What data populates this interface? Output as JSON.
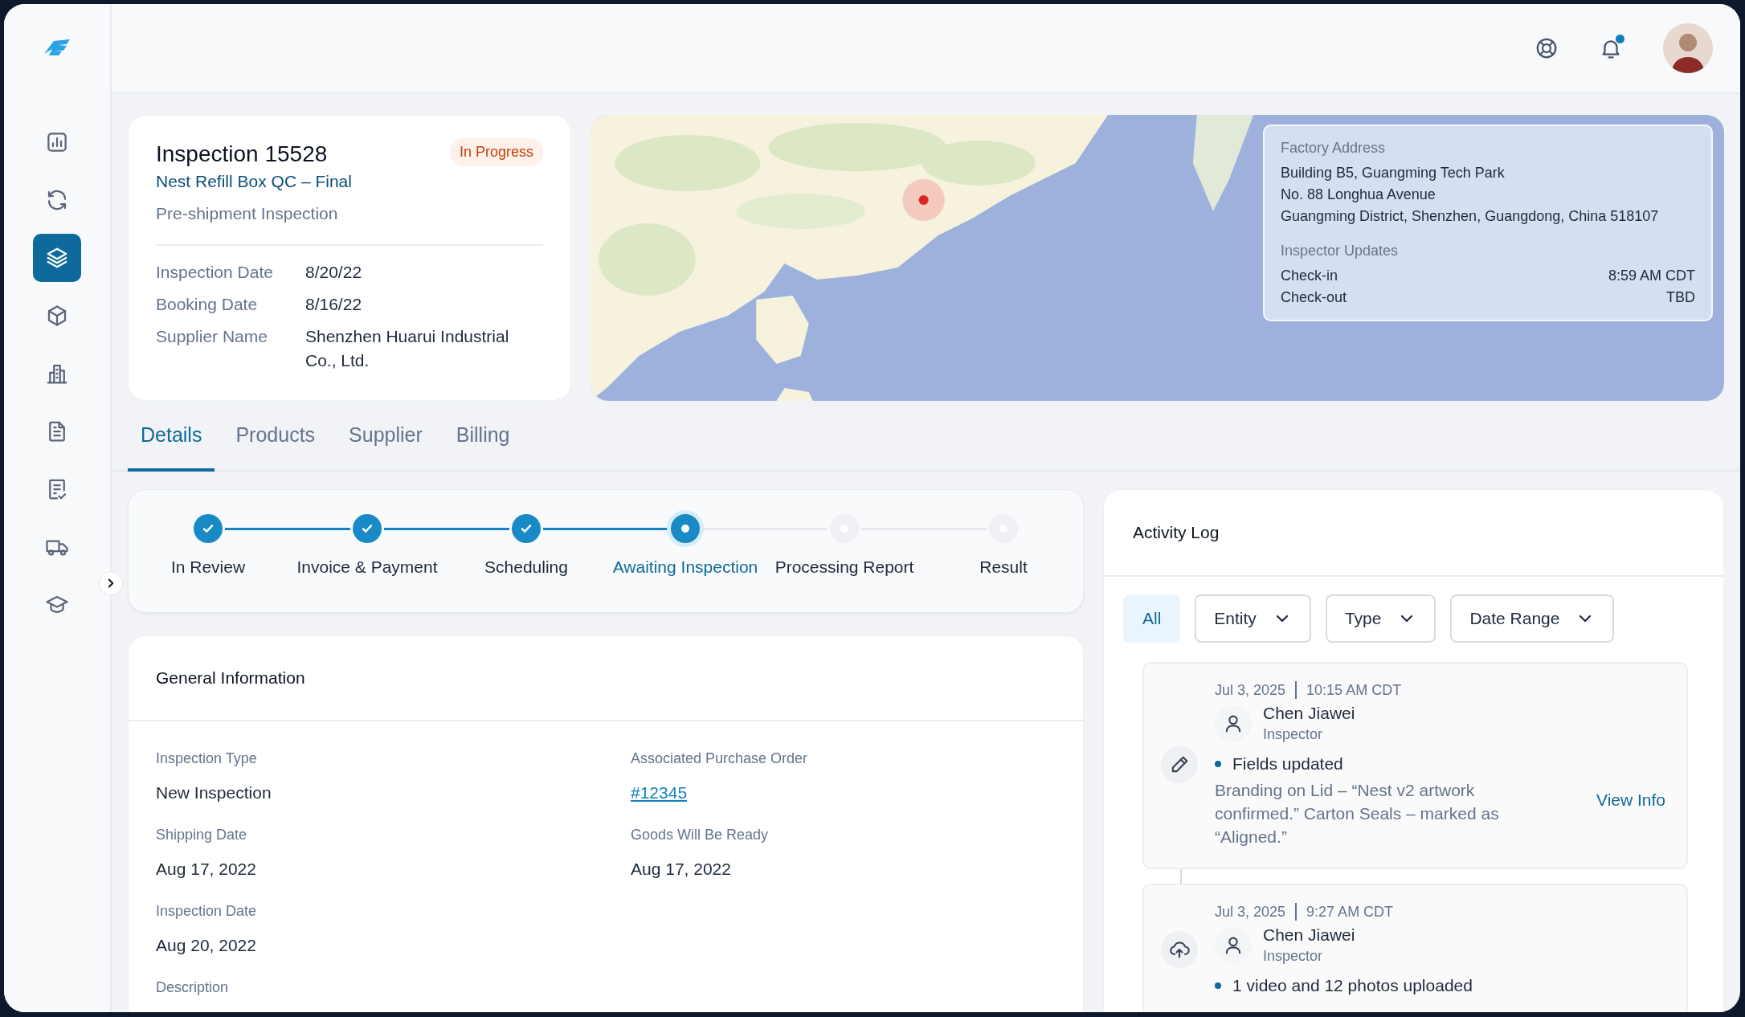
{
  "sidebar": {
    "items": [
      {
        "selected": false
      },
      {
        "selected": false
      },
      {
        "selected": true
      },
      {
        "selected": false
      },
      {
        "selected": false
      },
      {
        "selected": false
      },
      {
        "selected": false
      },
      {
        "selected": false
      },
      {
        "selected": false
      }
    ],
    "expanded": false
  },
  "topbar": {
    "unread_notifications": true
  },
  "inspection": {
    "title": "Inspection 15528",
    "status": "In Progress",
    "subtitle": "Nest Refill Box QC – Final",
    "type": "Pre-shipment Inspection",
    "fields": [
      {
        "label": "Inspection Date",
        "value": "8/20/22"
      },
      {
        "label": "Booking Date",
        "value": "8/16/22"
      },
      {
        "label": "Supplier Name",
        "value": "Shenzhen Huarui Industrial Co., Ltd."
      }
    ]
  },
  "factory": {
    "address_label": "Factory Address",
    "address_lines": [
      "Building B5, Guangming Tech Park",
      "No. 88 Longhua Avenue",
      "Guangming District, Shenzhen, Guangdong, China 518107"
    ],
    "updates_label": "Inspector Updates",
    "updates": [
      {
        "label": "Check-in",
        "value": "8:59 AM CDT"
      },
      {
        "label": "Check-out",
        "value": "TBD"
      }
    ]
  },
  "tabs": [
    {
      "label": "Details",
      "selected": true
    },
    {
      "label": "Products",
      "selected": false
    },
    {
      "label": "Supplier",
      "selected": false
    },
    {
      "label": "Billing",
      "selected": false
    }
  ],
  "steps": [
    {
      "label": "In Review",
      "completed": true,
      "selected": false
    },
    {
      "label": "Invoice & Payment",
      "completed": true,
      "selected": false
    },
    {
      "label": "Scheduling",
      "completed": true,
      "selected": false
    },
    {
      "label": "Awaiting Inspection",
      "completed": false,
      "selected": true
    },
    {
      "label": "Processing Report",
      "completed": false,
      "selected": false
    },
    {
      "label": "Result",
      "completed": false,
      "selected": false
    }
  ],
  "general": {
    "title": "General Information",
    "rows": [
      [
        {
          "label": "Inspection Type",
          "value": "New Inspection",
          "kind": "text"
        },
        {
          "label": "Associated Purchase Order",
          "value": "#12345",
          "kind": "link"
        }
      ],
      [
        {
          "label": "Shipping Date",
          "value": "Aug 17, 2022",
          "kind": "text"
        },
        {
          "label": "Goods Will Be Ready",
          "value": "Aug 17, 2022",
          "kind": "text"
        }
      ],
      [
        {
          "label": "Inspection Date",
          "value": "Aug 20, 2022",
          "kind": "text"
        }
      ],
      [
        {
          "label": "Description"
        }
      ]
    ]
  },
  "activity": {
    "title": "Activity Log",
    "filters": [
      {
        "label": "All",
        "selected": true,
        "kind": "chip"
      },
      {
        "label": "Entity",
        "selected": false,
        "kind": "dropdown"
      },
      {
        "label": "Type",
        "selected": false,
        "kind": "dropdown"
      },
      {
        "label": "Date Range",
        "selected": false,
        "kind": "dropdown"
      }
    ],
    "entries": [
      {
        "kind": "edit",
        "date": "Jul 3, 2025",
        "time": "10:15 AM CDT",
        "user": "Chen Jiawei",
        "role": "Inspector",
        "headline": "Fields updated",
        "detail": "Branding on Lid – “Nest v2 artwork confirmed.” Carton Seals – marked as “Aligned.”",
        "action": "View Info"
      },
      {
        "kind": "upload",
        "date": "Jul 3, 2025",
        "time": "9:27 AM CDT",
        "user": "Chen Jiawei",
        "role": "Inspector",
        "headline": "1 video and 12 photos uploaded"
      }
    ]
  }
}
